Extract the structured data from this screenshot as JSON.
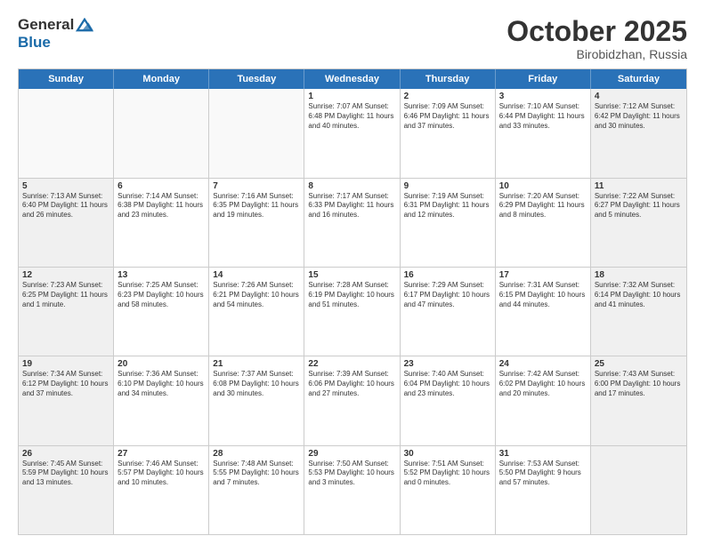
{
  "logo": {
    "general": "General",
    "blue": "Blue"
  },
  "title": "October 2025",
  "location": "Birobidzhan, Russia",
  "header_days": [
    "Sunday",
    "Monday",
    "Tuesday",
    "Wednesday",
    "Thursday",
    "Friday",
    "Saturday"
  ],
  "weeks": [
    [
      {
        "day": "",
        "content": "",
        "empty": true
      },
      {
        "day": "",
        "content": "",
        "empty": true
      },
      {
        "day": "",
        "content": "",
        "empty": true
      },
      {
        "day": "1",
        "content": "Sunrise: 7:07 AM\nSunset: 6:48 PM\nDaylight: 11 hours and 40 minutes."
      },
      {
        "day": "2",
        "content": "Sunrise: 7:09 AM\nSunset: 6:46 PM\nDaylight: 11 hours and 37 minutes."
      },
      {
        "day": "3",
        "content": "Sunrise: 7:10 AM\nSunset: 6:44 PM\nDaylight: 11 hours and 33 minutes."
      },
      {
        "day": "4",
        "content": "Sunrise: 7:12 AM\nSunset: 6:42 PM\nDaylight: 11 hours and 30 minutes.",
        "shaded": true
      }
    ],
    [
      {
        "day": "5",
        "content": "Sunrise: 7:13 AM\nSunset: 6:40 PM\nDaylight: 11 hours and 26 minutes.",
        "shaded": true
      },
      {
        "day": "6",
        "content": "Sunrise: 7:14 AM\nSunset: 6:38 PM\nDaylight: 11 hours and 23 minutes."
      },
      {
        "day": "7",
        "content": "Sunrise: 7:16 AM\nSunset: 6:35 PM\nDaylight: 11 hours and 19 minutes."
      },
      {
        "day": "8",
        "content": "Sunrise: 7:17 AM\nSunset: 6:33 PM\nDaylight: 11 hours and 16 minutes."
      },
      {
        "day": "9",
        "content": "Sunrise: 7:19 AM\nSunset: 6:31 PM\nDaylight: 11 hours and 12 minutes."
      },
      {
        "day": "10",
        "content": "Sunrise: 7:20 AM\nSunset: 6:29 PM\nDaylight: 11 hours and 8 minutes."
      },
      {
        "day": "11",
        "content": "Sunrise: 7:22 AM\nSunset: 6:27 PM\nDaylight: 11 hours and 5 minutes.",
        "shaded": true
      }
    ],
    [
      {
        "day": "12",
        "content": "Sunrise: 7:23 AM\nSunset: 6:25 PM\nDaylight: 11 hours and 1 minute.",
        "shaded": true
      },
      {
        "day": "13",
        "content": "Sunrise: 7:25 AM\nSunset: 6:23 PM\nDaylight: 10 hours and 58 minutes."
      },
      {
        "day": "14",
        "content": "Sunrise: 7:26 AM\nSunset: 6:21 PM\nDaylight: 10 hours and 54 minutes."
      },
      {
        "day": "15",
        "content": "Sunrise: 7:28 AM\nSunset: 6:19 PM\nDaylight: 10 hours and 51 minutes."
      },
      {
        "day": "16",
        "content": "Sunrise: 7:29 AM\nSunset: 6:17 PM\nDaylight: 10 hours and 47 minutes."
      },
      {
        "day": "17",
        "content": "Sunrise: 7:31 AM\nSunset: 6:15 PM\nDaylight: 10 hours and 44 minutes."
      },
      {
        "day": "18",
        "content": "Sunrise: 7:32 AM\nSunset: 6:14 PM\nDaylight: 10 hours and 41 minutes.",
        "shaded": true
      }
    ],
    [
      {
        "day": "19",
        "content": "Sunrise: 7:34 AM\nSunset: 6:12 PM\nDaylight: 10 hours and 37 minutes.",
        "shaded": true
      },
      {
        "day": "20",
        "content": "Sunrise: 7:36 AM\nSunset: 6:10 PM\nDaylight: 10 hours and 34 minutes."
      },
      {
        "day": "21",
        "content": "Sunrise: 7:37 AM\nSunset: 6:08 PM\nDaylight: 10 hours and 30 minutes."
      },
      {
        "day": "22",
        "content": "Sunrise: 7:39 AM\nSunset: 6:06 PM\nDaylight: 10 hours and 27 minutes."
      },
      {
        "day": "23",
        "content": "Sunrise: 7:40 AM\nSunset: 6:04 PM\nDaylight: 10 hours and 23 minutes."
      },
      {
        "day": "24",
        "content": "Sunrise: 7:42 AM\nSunset: 6:02 PM\nDaylight: 10 hours and 20 minutes."
      },
      {
        "day": "25",
        "content": "Sunrise: 7:43 AM\nSunset: 6:00 PM\nDaylight: 10 hours and 17 minutes.",
        "shaded": true
      }
    ],
    [
      {
        "day": "26",
        "content": "Sunrise: 7:45 AM\nSunset: 5:59 PM\nDaylight: 10 hours and 13 minutes.",
        "shaded": true
      },
      {
        "day": "27",
        "content": "Sunrise: 7:46 AM\nSunset: 5:57 PM\nDaylight: 10 hours and 10 minutes."
      },
      {
        "day": "28",
        "content": "Sunrise: 7:48 AM\nSunset: 5:55 PM\nDaylight: 10 hours and 7 minutes."
      },
      {
        "day": "29",
        "content": "Sunrise: 7:50 AM\nSunset: 5:53 PM\nDaylight: 10 hours and 3 minutes."
      },
      {
        "day": "30",
        "content": "Sunrise: 7:51 AM\nSunset: 5:52 PM\nDaylight: 10 hours and 0 minutes."
      },
      {
        "day": "31",
        "content": "Sunrise: 7:53 AM\nSunset: 5:50 PM\nDaylight: 9 hours and 57 minutes."
      },
      {
        "day": "",
        "content": "",
        "empty": true,
        "shaded": true
      }
    ]
  ]
}
